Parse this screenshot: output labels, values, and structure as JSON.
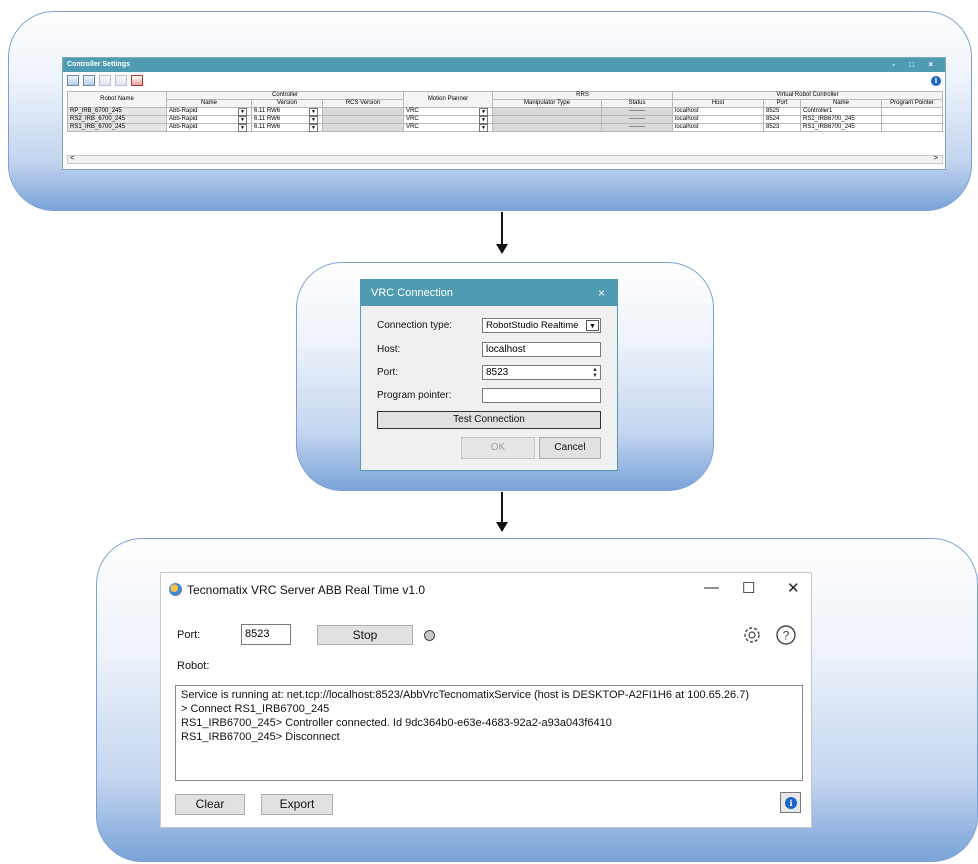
{
  "controller_settings": {
    "title": "Controller Settings",
    "window_buttons": "- □ ×",
    "columns": {
      "robot_name": "Robot Name",
      "controller": "Controller",
      "controller_name": "Name",
      "version": "Version",
      "rcs_version": "RCS Version",
      "motion_planner": "Motion Planner",
      "rrs": "RRS",
      "manipulator_type": "Manipulator Type",
      "status": "Status",
      "virtual_robot_controller": "Virtual Robot Controller",
      "host": "Host",
      "port": "Port",
      "vrc_name": "Name",
      "program_pointer": "Program Pointer"
    },
    "rows": [
      {
        "robot": "RP_IRB_6700_245",
        "name": "Abb-Rapid",
        "version": "6.11 RW6",
        "planner": "VRC",
        "status": "--------",
        "host": "localhost",
        "port": "8525",
        "vrc_name": "Controller1"
      },
      {
        "robot": "RS2_IRB_6700_245",
        "name": "Abb-Rapid",
        "version": "6.11 RW6",
        "planner": "VRC",
        "status": "--------",
        "host": "localhost",
        "port": "8524",
        "vrc_name": "RS2_IRB6700_245"
      },
      {
        "robot": "RS1_IRB_6700_245",
        "name": "Abb-Rapid",
        "version": "6.11 RW6",
        "planner": "VRC",
        "status": "--------",
        "host": "localhost",
        "port": "8523",
        "vrc_name": "RS1_IRB6700_245"
      }
    ]
  },
  "vrc_connection": {
    "title": "VRC Connection",
    "close": "×",
    "connection_type_label": "Connection type:",
    "connection_type_value": "RobotStudio Realtime",
    "host_label": "Host:",
    "host_value": "localhost",
    "port_label": "Port:",
    "port_value": "8523",
    "program_pointer_label": "Program pointer:",
    "program_pointer_value": "",
    "test_button": "Test Connection",
    "ok_button": "OK",
    "cancel_button": "Cancel"
  },
  "tecnomatix": {
    "title": "Tecnomatix VRC Server ABB Real Time v1.0",
    "minimize": "—",
    "maximize": "☐",
    "close": "✕",
    "port_label": "Port:",
    "port_value": "8523",
    "stop_button": "Stop",
    "robot_label": "Robot:",
    "log": [
      "Service is running at: net.tcp://localhost:8523/AbbVrcTecnomatixService (host is DESKTOP-A2FI1H6 at 100.65.26.7)",
      "> Connect RS1_IRB6700_245",
      "RS1_IRB6700_245> Controller connected. Id 9dc364b0-e63e-4683-92a2-a93a043f6410",
      "RS1_IRB6700_245> Disconnect"
    ],
    "clear_button": "Clear",
    "export_button": "Export"
  }
}
